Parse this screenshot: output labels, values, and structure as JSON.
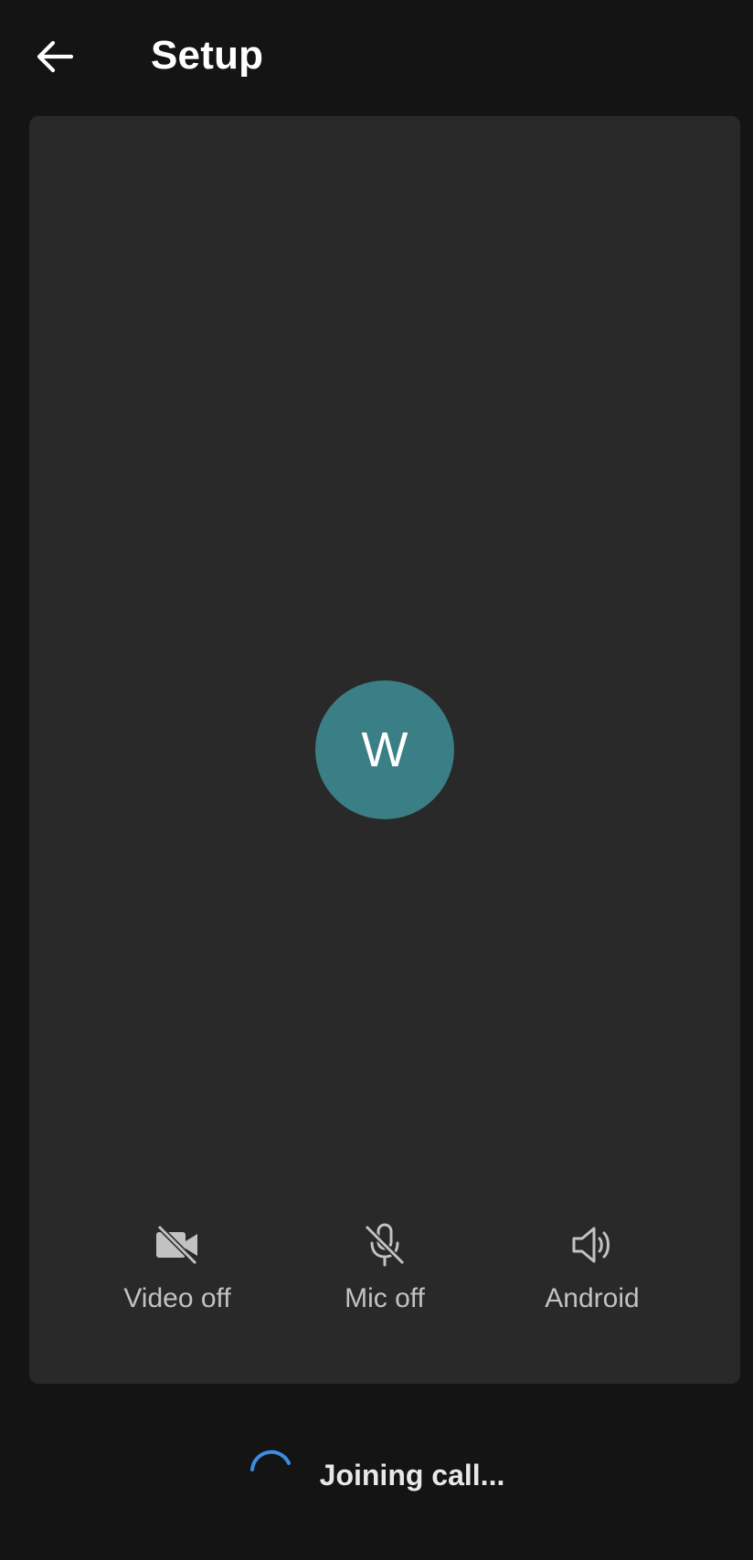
{
  "header": {
    "title": "Setup",
    "back_icon": "arrow-left-icon"
  },
  "preview": {
    "avatar_initial": "W",
    "avatar_color": "#3a7e86"
  },
  "controls": [
    {
      "icon": "video-off-icon",
      "label": "Video off"
    },
    {
      "icon": "mic-off-icon",
      "label": "Mic off"
    },
    {
      "icon": "speaker-icon",
      "label": "Android"
    }
  ],
  "status": {
    "text": "Joining call...",
    "spinner_color": "#3b8de0"
  },
  "colors": {
    "background": "#141414",
    "card": "#292929",
    "label": "#c2c2c2"
  }
}
